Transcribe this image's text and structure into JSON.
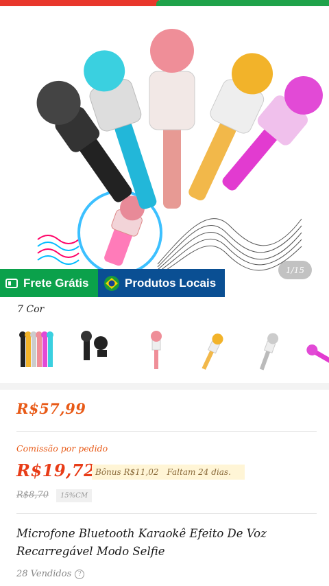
{
  "top_bar": {
    "left_color": "#e8372b",
    "right_color": "#1fa24a"
  },
  "gallery": {
    "pager": "1/15"
  },
  "badges": {
    "shipping": {
      "label": "Frete Grátis",
      "icon": "truck-icon",
      "color": "#0ba14b"
    },
    "local": {
      "label": "Produtos Locais",
      "icon": "brazil-flag-icon",
      "color": "#0a4f93"
    }
  },
  "variants": {
    "label": "7 Cor",
    "items": [
      "all-colors",
      "black",
      "pink",
      "gold",
      "silver",
      "magenta"
    ]
  },
  "product": {
    "price": "R$57,99",
    "commission_label": "Comissão por pedido",
    "commission_value": "R$19,72",
    "bonus_text": "Bônus R$11,02",
    "deadline_text": "Faltam 24 dias.",
    "old_price": "R$8,70",
    "commission_rate": "15%CM",
    "title": "Microfone  Bluetooth  Karaokê Efeito De Voz Recarregável Modo Selfie",
    "sold": "28 Vendidos"
  },
  "colors": {
    "accent": "#e85a17",
    "price": "#e83c17"
  }
}
